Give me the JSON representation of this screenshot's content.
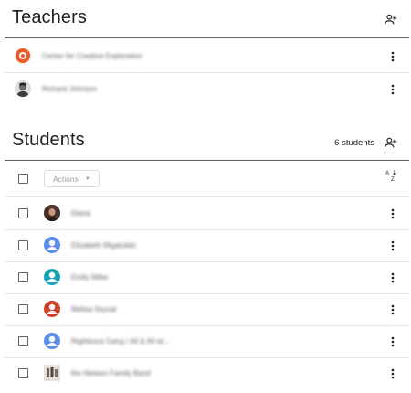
{
  "teachers": {
    "title": "Teachers",
    "add_icon": "add-person-icon",
    "items": [
      {
        "name": "Center for Creative Exploration",
        "avatar": "org-logo"
      },
      {
        "name": "Richard Johnson",
        "avatar": "photo"
      }
    ]
  },
  "students": {
    "title": "Students",
    "count": "6 students",
    "add_icon": "add-person-icon",
    "actions_label": "Actions",
    "sort_icon": "sort-az-icon",
    "items": [
      {
        "name": "Diana",
        "avatar": "photo-dark"
      },
      {
        "name": "Elizabeth Migatulski",
        "avatar": "default-person",
        "color": "#5b8def"
      },
      {
        "name": "Emily Miller",
        "avatar": "default-person",
        "color": "#16a4b5"
      },
      {
        "name": "Melisa Soysal",
        "avatar": "default-person",
        "color": "#d4412b"
      },
      {
        "name": "Righteous Gang / All & All wi...",
        "avatar": "default-person",
        "color": "#5b8def"
      },
      {
        "name": "the Nielsen Family Band",
        "avatar": "photo-group"
      }
    ]
  },
  "colors": {
    "accent": "#5f6368",
    "divider": "#e6e6e6",
    "org_logo": "#ea5a2b"
  }
}
